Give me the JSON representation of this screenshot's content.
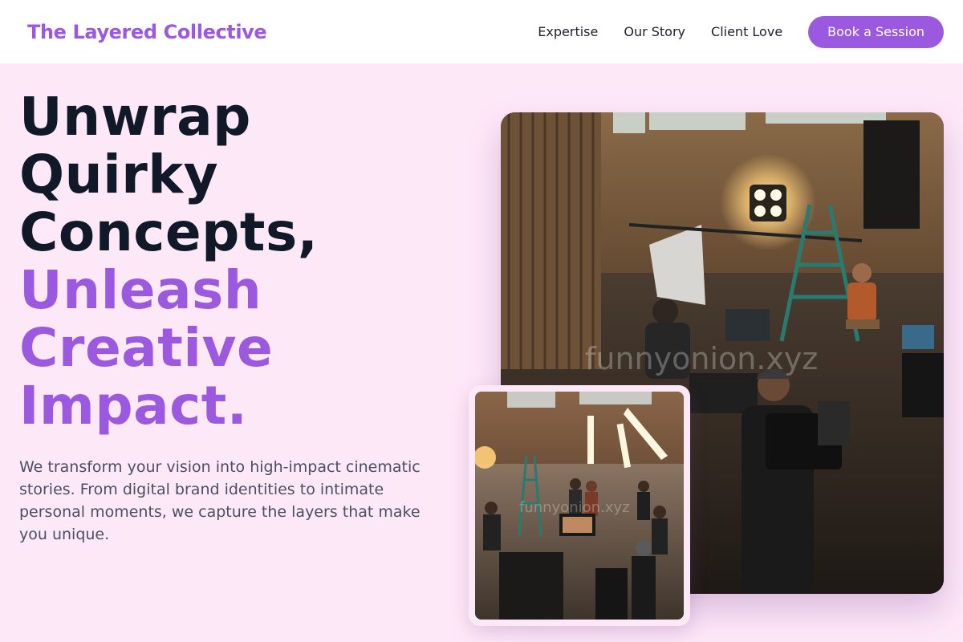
{
  "header": {
    "brand": "The Layered Collective",
    "nav": [
      {
        "label": "Expertise"
      },
      {
        "label": "Our Story"
      },
      {
        "label": "Client Love"
      }
    ],
    "cta_label": "Book a Session"
  },
  "hero": {
    "title_lines_dark": [
      "Unwrap",
      "Quirky",
      "Concepts,"
    ],
    "title_lines_accent": [
      "Unleash",
      "Creative",
      "Impact."
    ],
    "description": "We transform your vision into high-impact cinematic stories. From digital brand identities to intimate personal moments, we capture the layers that make you unique."
  },
  "images": {
    "main_watermark": "funnyonion.xyz",
    "small_watermark": "funnyonion.xyz"
  },
  "colors": {
    "accent": "#9b59e0",
    "background": "#fde8f8",
    "heading_dark": "#111827",
    "body_text": "#4a4f63"
  }
}
